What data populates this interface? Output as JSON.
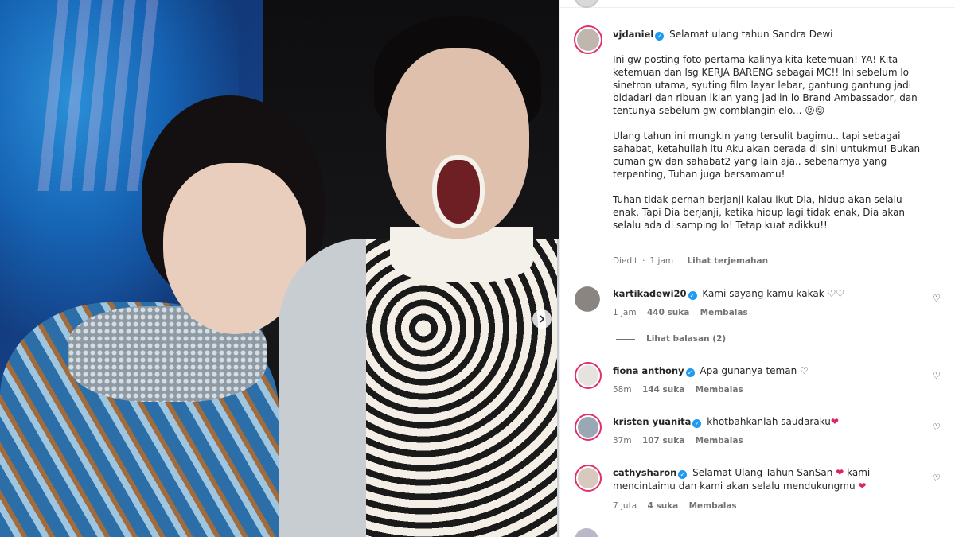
{
  "post": {
    "author": "vjdaniel",
    "caption_title": "Selamat ulang tahun Sandra Dewi",
    "paragraphs": [
      "Ini gw posting foto pertama kalinya kita ketemuan! YA! Kita ketemuan dan lsg KERJA BARENG sebagai MC!! Ini sebelum lo sinetron utama, syuting film layar lebar, gantung gantung jadi bidadari dan ribuan iklan yang jadiin lo Brand Ambassador, dan tentunya sebelum gw comblangin elo... 😝😝",
      "Ulang tahun ini mungkin yang tersulit bagimu.. tapi sebagai sahabat, ketahuilah itu Aku akan berada di sini untukmu! Bukan cuman gw dan sahabat2 yang lain aja.. sebenarnya yang terpenting, Tuhan juga bersamamu!",
      "Tuhan tidak pernah berjanji kalau ikut Dia, hidup akan selalu enak. Tapi Dia berjanji, ketika hidup lagi tidak enak, Dia akan selalu ada di samping lo! Tetap kuat adikku!!"
    ],
    "edited_label": "Diedit",
    "time": "1 jam",
    "translate_label": "Lihat terjemahan"
  },
  "comments": [
    {
      "user": "kartikadewi20",
      "text": "Kami sayang kamu kakak ♡♡",
      "time": "1 jam",
      "likes": "440 suka",
      "reply": "Membalas",
      "view_replies": "Lihat balasan (2)"
    },
    {
      "user": "fiona anthony",
      "text": "Apa gunanya teman ♡",
      "time": "58m",
      "likes": "144 suka",
      "reply": "Membalas"
    },
    {
      "user": "kristen yuanita",
      "text": "khotbahkanlah saudaraku",
      "text_suffix": "❤",
      "time": "37m",
      "likes": "107 suka",
      "reply": "Membalas"
    },
    {
      "user": "cathysharon",
      "text": "Selamat Ulang Tahun SanSan",
      "text_middle": "❤",
      "text_cont": "kami mencintaimu dan kami akan selalu mendukungmu",
      "text_suffix": "❤",
      "time": "7 juta",
      "likes": "4 suka",
      "reply": "Membalas"
    }
  ],
  "icons": {
    "verified": "verified-badge-icon",
    "like": "heart-outline-icon",
    "next": "chevron-right-icon"
  },
  "colors": {
    "verified": "#1d9bf0",
    "heart_red": "#e0245e",
    "meta_gray": "#737373"
  }
}
